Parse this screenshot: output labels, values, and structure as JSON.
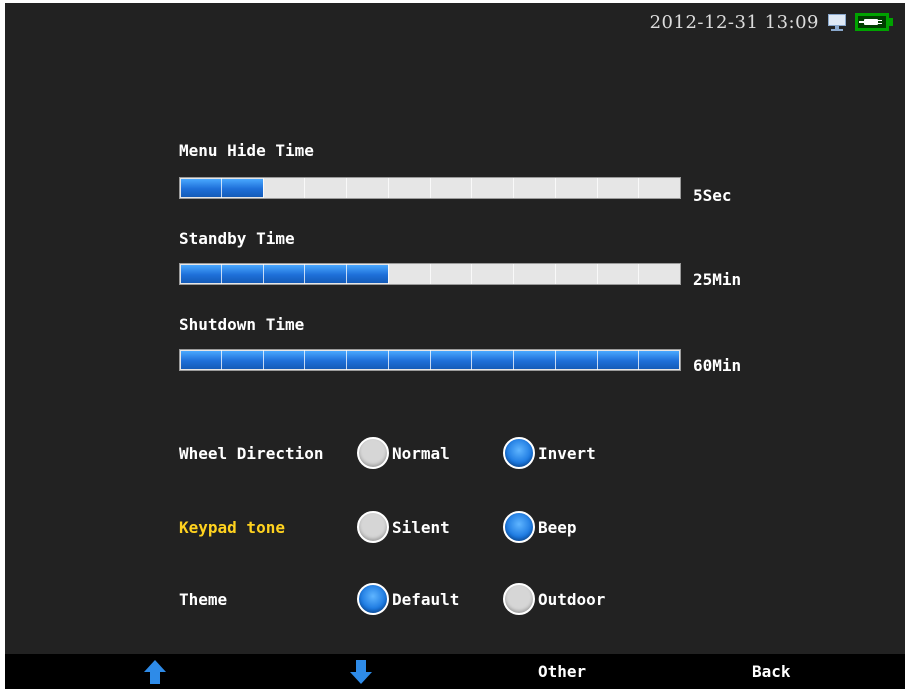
{
  "status_bar": {
    "datetime": "2012-12-31 13:09",
    "icons": [
      "monitor-icon",
      "battery-charging-icon"
    ]
  },
  "settings": {
    "menu_hide_time": {
      "label": "Menu Hide Time",
      "value": "5Sec",
      "level": 0.167
    },
    "standby_time": {
      "label": "Standby Time",
      "value": "25Min",
      "level": 0.417
    },
    "shutdown_time": {
      "label": "Shutdown Time",
      "value": "60Min",
      "level": 1.0
    },
    "wheel_direction": {
      "label": "Wheel Direction",
      "options": [
        "Normal",
        "Invert"
      ],
      "selected": "Invert"
    },
    "keypad_tone": {
      "label": "Keypad tone",
      "options": [
        "Silent",
        "Beep"
      ],
      "selected": "Beep"
    },
    "theme": {
      "label": "Theme",
      "options": [
        "Default",
        "Outdoor"
      ],
      "selected": "Default"
    }
  },
  "softkeys": {
    "up_icon": "up-arrow-icon",
    "down_icon": "down-arrow-icon",
    "other": "Other",
    "back": "Back"
  },
  "colors": {
    "background": "#222222",
    "accent": "#1e6fd8",
    "highlight": "#ffd21f",
    "battery": "#00a300"
  }
}
